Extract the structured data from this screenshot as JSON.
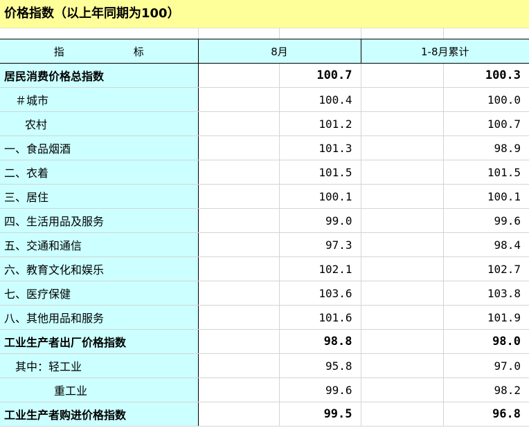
{
  "title": "价格指数（以上年同期为100）",
  "header": {
    "indicator": "指  标",
    "col_month": "8月",
    "col_cum": "1-8月累计"
  },
  "rows": [
    {
      "name": "居民消费价格总指数",
      "month": "100.7",
      "cum": "100.3",
      "bold": true,
      "indent": 0
    },
    {
      "name": "＃城市",
      "month": "100.4",
      "cum": "100.0",
      "bold": false,
      "indent": 1
    },
    {
      "name": "农村",
      "month": "101.2",
      "cum": "100.7",
      "bold": false,
      "indent": 2
    },
    {
      "name": "一、食品烟酒",
      "month": "101.3",
      "cum": "98.9",
      "bold": false,
      "indent": 0
    },
    {
      "name": "二、衣着",
      "month": "101.5",
      "cum": "101.5",
      "bold": false,
      "indent": 0
    },
    {
      "name": "三、居住",
      "month": "100.1",
      "cum": "100.1",
      "bold": false,
      "indent": 0
    },
    {
      "name": "四、生活用品及服务",
      "month": "99.0",
      "cum": "99.6",
      "bold": false,
      "indent": 0
    },
    {
      "name": "五、交通和通信",
      "month": "97.3",
      "cum": "98.4",
      "bold": false,
      "indent": 0
    },
    {
      "name": "六、教育文化和娱乐",
      "month": "102.1",
      "cum": "102.7",
      "bold": false,
      "indent": 0
    },
    {
      "name": "七、医疗保健",
      "month": "103.6",
      "cum": "103.8",
      "bold": false,
      "indent": 0
    },
    {
      "name": "八、其他用品和服务",
      "month": "101.6",
      "cum": "101.9",
      "bold": false,
      "indent": 0
    },
    {
      "name": "工业生产者出厂价格指数",
      "month": "98.8",
      "cum": "98.0",
      "bold": true,
      "indent": 0
    },
    {
      "name": "其中：轻工业",
      "month": "95.8",
      "cum": "97.0",
      "bold": false,
      "indent": 1
    },
    {
      "name": "重工业",
      "month": "99.6",
      "cum": "98.2",
      "bold": false,
      "indent": 3
    },
    {
      "name": "工业生产者购进价格指数",
      "month": "99.5",
      "cum": "96.8",
      "bold": true,
      "indent": 0
    }
  ]
}
